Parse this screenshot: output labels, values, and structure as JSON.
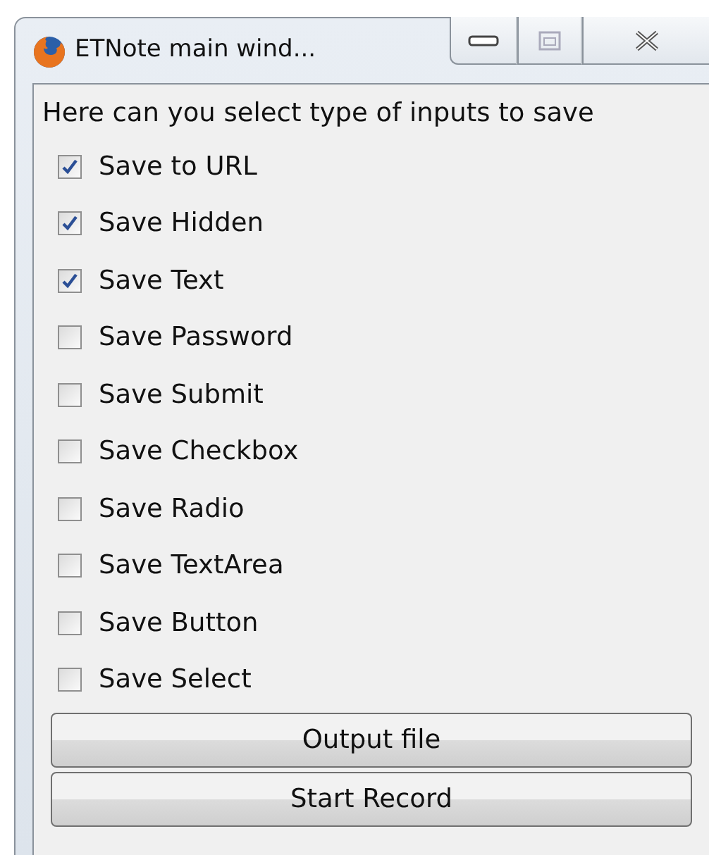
{
  "window": {
    "title": "ETNote main wind...",
    "maximize_disabled": true
  },
  "heading": "Here can you select type of inputs to save",
  "options": [
    {
      "label": "Save to URL",
      "checked": true
    },
    {
      "label": "Save Hidden",
      "checked": true
    },
    {
      "label": "Save Text",
      "checked": true
    },
    {
      "label": "Save Password",
      "checked": false
    },
    {
      "label": "Save Submit",
      "checked": false
    },
    {
      "label": "Save Checkbox",
      "checked": false
    },
    {
      "label": "Save Radio",
      "checked": false
    },
    {
      "label": "Save TextArea",
      "checked": false
    },
    {
      "label": "Save Button",
      "checked": false
    },
    {
      "label": "Save Select",
      "checked": false
    }
  ],
  "buttons": [
    "Output file",
    "Start Record"
  ]
}
